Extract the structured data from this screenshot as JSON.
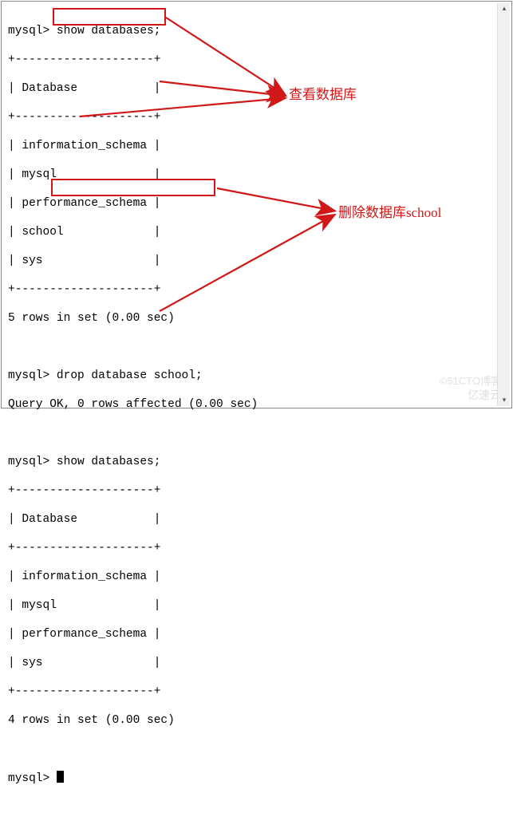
{
  "prompt": "mysql>",
  "cmd_show1": "show databases;",
  "sep_long": "+--------------------+",
  "hdr": "| Database           |",
  "rows1": [
    "| information_schema |",
    "| mysql              |",
    "| performance_schema |",
    "| school             |",
    "| sys                |"
  ],
  "summary1": "5 rows in set (0.00 sec)",
  "cmd_drop": "drop database school;",
  "drop_result": "Query OK, 0 rows affected (0.00 sec)",
  "cmd_show2": "show databases;",
  "rows2": [
    "| information_schema |",
    "| mysql              |",
    "| performance_schema |",
    "| sys                |"
  ],
  "summary2": "4 rows in set (0.00 sec)",
  "annot1": "查看数据库",
  "annot2": "删除数据库school",
  "watermark1": "©51CTO博客",
  "watermark2": "亿速云"
}
